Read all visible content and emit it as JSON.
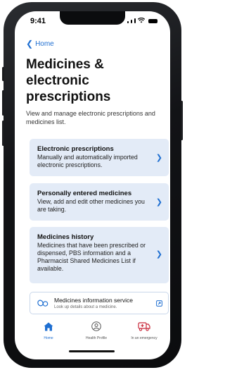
{
  "status_bar": {
    "time": "9:41"
  },
  "nav": {
    "back_label": "Home"
  },
  "page": {
    "title": "Medicines & electronic prescriptions",
    "subtitle": "View and manage electronic prescriptions and medicines list."
  },
  "cards": [
    {
      "title": "Electronic prescriptions",
      "description": "Manually and automatically imported electronic prescriptions."
    },
    {
      "title": "Personally entered medicines",
      "description": "View, add and edit other medicines you are taking."
    },
    {
      "title": "Medicines history",
      "description": "Medicines that have been prescribed or dispensed, PBS information and a Pharmacist Shared Medicines List if available."
    }
  ],
  "info_service": {
    "title": "Medicines information service",
    "description": "Look up details about a medicine."
  },
  "tabs": [
    {
      "label": "Home",
      "icon": "home-icon",
      "active": true
    },
    {
      "label": "Health Profile",
      "icon": "profile-icon",
      "active": false
    },
    {
      "label": "In an emergency",
      "icon": "emergency-icon",
      "active": false
    }
  ],
  "colors": {
    "accent": "#1f6fd1",
    "card_background": "#e3ebf7",
    "emergency": "#c8283a"
  }
}
